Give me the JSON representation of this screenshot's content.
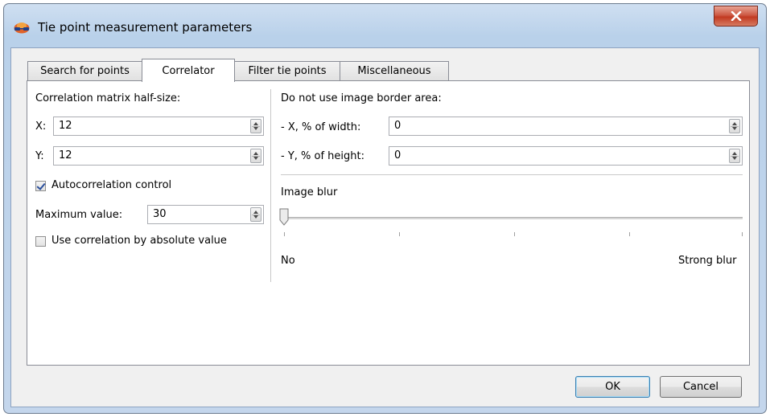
{
  "window": {
    "title": "Tie point measurement parameters"
  },
  "tabs": [
    {
      "label": "Search for points",
      "active": false
    },
    {
      "label": "Correlator",
      "active": true
    },
    {
      "label": "Filter tie points",
      "active": false
    },
    {
      "label": "Miscellaneous",
      "active": false
    }
  ],
  "correlator": {
    "matrix_label": "Correlation matrix half-size:",
    "x_label": "X:",
    "x_value": "12",
    "y_label": "Y:",
    "y_value": "12",
    "autocorrelation_label": "Autocorrelation control",
    "autocorrelation_checked": true,
    "max_label": "Maximum value:",
    "max_value": "30",
    "absolute_label": "Use correlation by absolute value",
    "absolute_checked": false,
    "border_label": "Do not use image border area:",
    "border_x_label": "- X, % of width:",
    "border_x_value": "0",
    "border_y_label": "- Y, % of height:",
    "border_y_value": "0",
    "blur_label": "Image blur",
    "blur_level": 0,
    "blur_min_label": "No",
    "blur_max_label": "Strong blur"
  },
  "buttons": {
    "ok": "OK",
    "cancel": "Cancel"
  },
  "colors": {
    "titlebar": "#b9d1ea",
    "close": "#c23a21",
    "panel": "#ffffff",
    "default_border": "#3c7fb1"
  }
}
